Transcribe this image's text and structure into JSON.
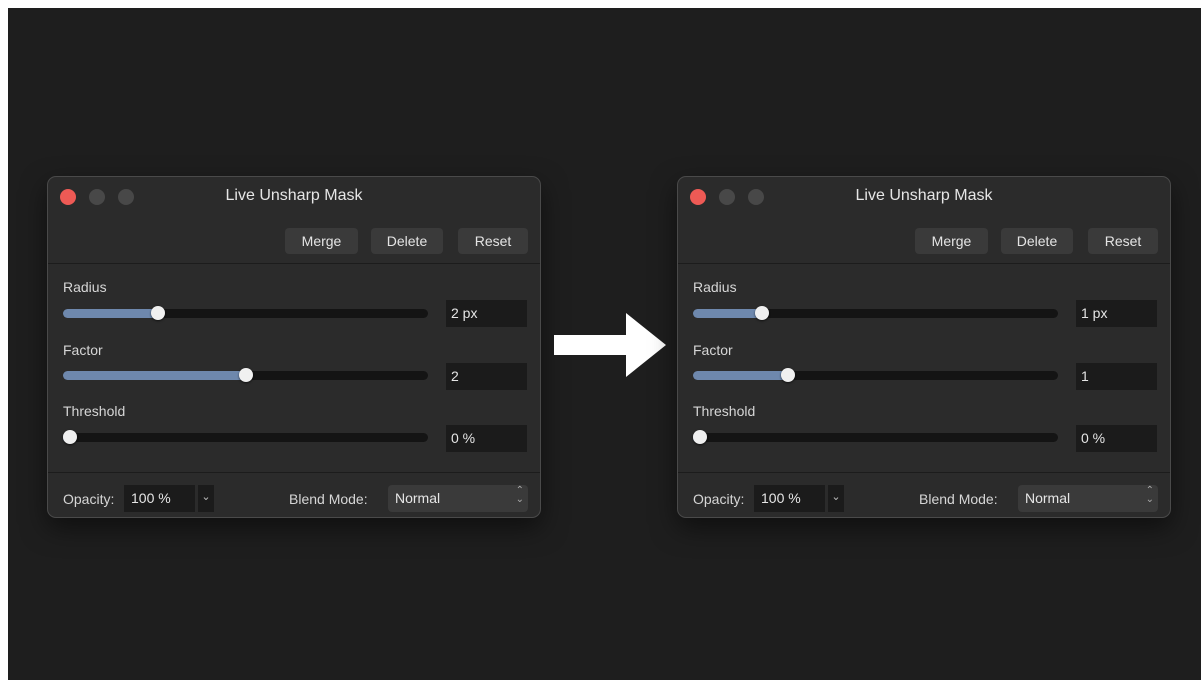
{
  "panels": [
    {
      "title": "Live Unsharp Mask",
      "buttons": {
        "merge": "Merge",
        "delete": "Delete",
        "reset": "Reset"
      },
      "radius": {
        "label": "Radius",
        "value": "2 px",
        "level": 0.26
      },
      "factor": {
        "label": "Factor",
        "value": "2",
        "level": 0.5
      },
      "threshold": {
        "label": "Threshold",
        "value": "0 %",
        "level": 0.02
      },
      "opacity": {
        "label": "Opacity:",
        "value": "100 %"
      },
      "blend_mode": {
        "label": "Blend Mode:",
        "value": "Normal"
      }
    },
    {
      "title": "Live Unsharp Mask",
      "buttons": {
        "merge": "Merge",
        "delete": "Delete",
        "reset": "Reset"
      },
      "radius": {
        "label": "Radius",
        "value": "1 px",
        "level": 0.19
      },
      "factor": {
        "label": "Factor",
        "value": "1",
        "level": 0.26
      },
      "threshold": {
        "label": "Threshold",
        "value": "0 %",
        "level": 0.02
      },
      "opacity": {
        "label": "Opacity:",
        "value": "100 %"
      },
      "blend_mode": {
        "label": "Blend Mode:",
        "value": "Normal"
      }
    }
  ],
  "colors": {
    "close": "#ee5a55",
    "slider_fill": "#6e88ad",
    "background": "#1e1e1e",
    "panel": "#2b2b2b"
  },
  "icons": {
    "dropdown": "chevron-down-icon",
    "stepper": "up-down-arrows-icon",
    "transition": "right-arrow-icon"
  }
}
